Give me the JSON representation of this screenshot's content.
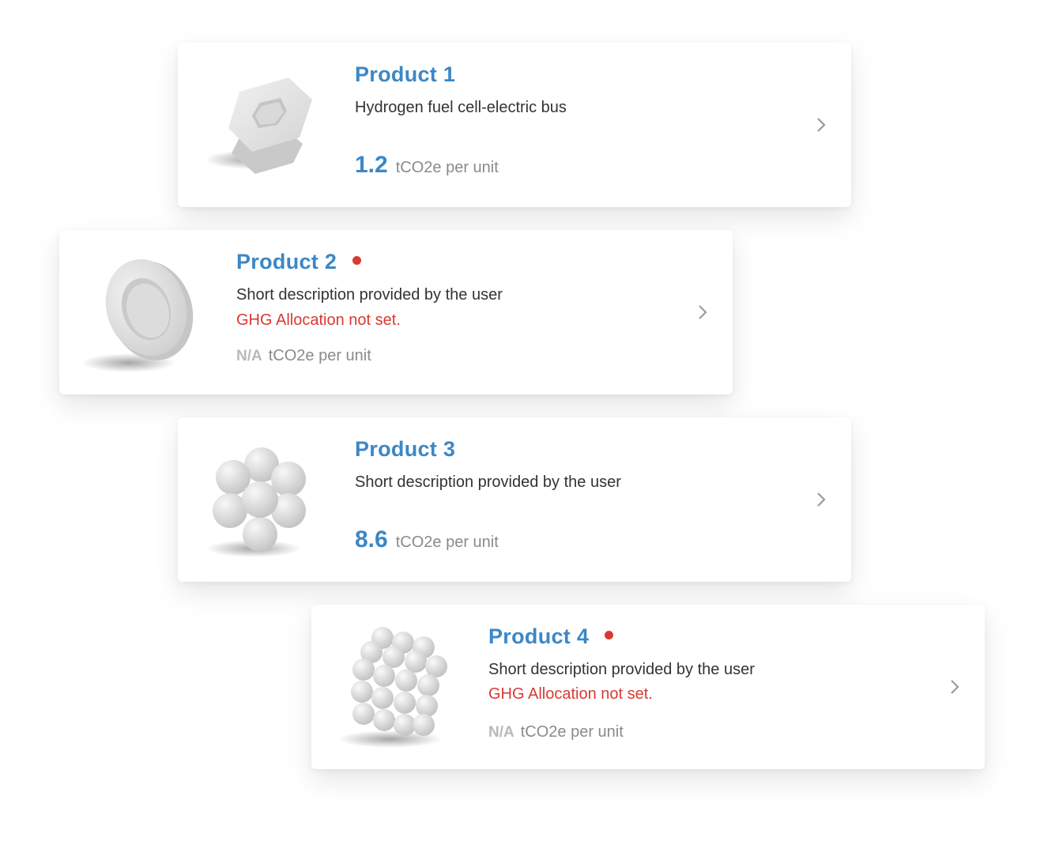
{
  "products": [
    {
      "title": "Product 1",
      "description": "Hydrogen fuel cell-electric bus",
      "warning": "",
      "value": "1.2",
      "unit": "tCO2e per unit",
      "has_alert": false,
      "shape": "hexagonal-nut"
    },
    {
      "title": "Product 2",
      "description": "Short description provided by the user",
      "warning": "GHG Allocation not set.",
      "value": "N/A",
      "unit": "tCO2e per unit",
      "has_alert": true,
      "shape": "ring-disc"
    },
    {
      "title": "Product 3",
      "description": "Short description provided by the user",
      "warning": "",
      "value": "8.6",
      "unit": "tCO2e per unit",
      "has_alert": false,
      "shape": "sphere-flower-cluster"
    },
    {
      "title": "Product 4",
      "description": "Short description provided by the user",
      "warning": "GHG Allocation not set.",
      "value": "N/A",
      "unit": "tCO2e per unit",
      "has_alert": true,
      "shape": "sphere-cube-cluster"
    }
  ],
  "colors": {
    "accent": "#3c87c6",
    "alert": "#d83a33",
    "muted": "#8a8a8a",
    "na": "#b9b9b9",
    "text": "#333333"
  }
}
